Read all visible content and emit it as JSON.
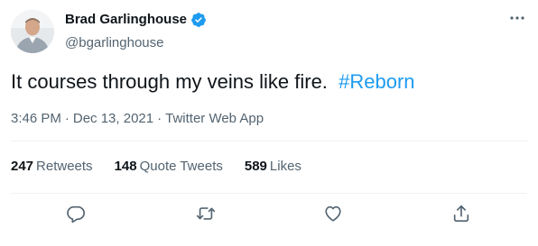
{
  "author": {
    "display_name": "Brad Garlinghouse",
    "handle": "@bgarlinghouse",
    "verified_icon": "verified-badge-icon",
    "avatar_icon": "avatar"
  },
  "tweet": {
    "text_main": "It courses through my veins like fire.",
    "hashtag": "#Reborn",
    "time": "3:46 PM",
    "date": "Dec 13, 2021",
    "source": "Twitter Web App",
    "separator": "·"
  },
  "stats": {
    "retweets_count": "247",
    "retweets_label": "Retweets",
    "quotes_count": "148",
    "quotes_label": "Quote Tweets",
    "likes_count": "589",
    "likes_label": "Likes"
  },
  "actions": {
    "reply_icon": "reply-icon",
    "retweet_icon": "retweet-icon",
    "like_icon": "heart-icon",
    "share_icon": "share-icon",
    "more_icon": "more-icon"
  },
  "colors": {
    "accent": "#1d9bf0",
    "text": "#0f1419",
    "secondary": "#536471",
    "divider": "#eff3f4"
  }
}
